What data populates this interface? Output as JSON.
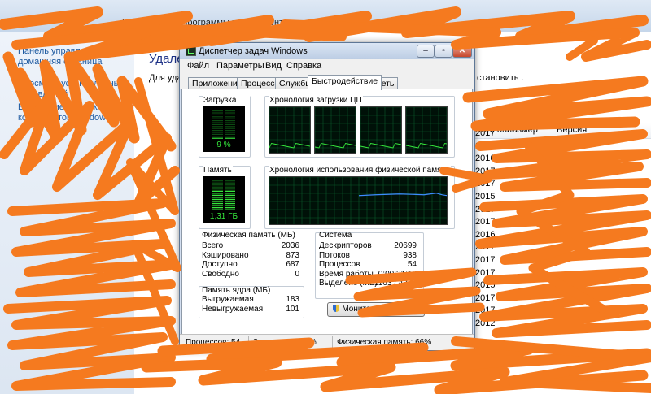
{
  "background_window": {
    "breadcrumb": [
      "Компоненты",
      "Программы и компоненты"
    ],
    "left_links": [
      "Панель управления -",
      "домашняя страница",
      "Просмотр установленных",
      "обновлений",
      "Включение или отключение",
      "компонентов Windows"
    ],
    "heading": "Удале",
    "subtext": "Для удал",
    "subtext_right": "становить .",
    "columns": [
      "Установле...",
      "Размер",
      "Версия"
    ],
    "rows": [
      {
        "date": "2017",
        "size": ""
      },
      {
        "date": "2017",
        "size": ""
      },
      {
        "date": "2016",
        "size": ""
      },
      {
        "date": "2017",
        "size": ""
      },
      {
        "date": "2017",
        "size": ""
      },
      {
        "date": "2015",
        "size": ""
      },
      {
        "date": "2017",
        "size": ""
      },
      {
        "date": "2017",
        "size": ""
      },
      {
        "date": "2016",
        "size": ""
      },
      {
        "date": "2017",
        "size": ""
      },
      {
        "date": "2017",
        "size": ""
      },
      {
        "date": "2017",
        "size": ""
      },
      {
        "date": "2015",
        "size": ""
      },
      {
        "date": "2017",
        "size": ""
      },
      {
        "date": "2017",
        "size": ""
      },
      {
        "date": "2012",
        "size": ""
      }
    ]
  },
  "task_manager": {
    "title": "Диспетчер задач Windows",
    "menu": [
      "Файл",
      "Параметры",
      "Вид",
      "Справка"
    ],
    "tabs": [
      "Приложения",
      "Процессы",
      "Службы",
      "Быстродействие",
      "Сеть"
    ],
    "active_tab": "Быстродействие",
    "cpu_usage": {
      "caption": "Загрузка ЦП",
      "value": "9 %",
      "level": 0.09
    },
    "cpu_history": {
      "caption": "Хронология загрузки ЦП",
      "cores": 4
    },
    "memory": {
      "caption": "Память",
      "value": "1,31 ГБ",
      "level": 0.66
    },
    "memory_history": {
      "caption": "Хронология использования физической памяти"
    },
    "physical_memory": {
      "title": "Физическая память (МБ)",
      "rows": [
        {
          "label": "Всего",
          "value": "2036"
        },
        {
          "label": "Кэшировано",
          "value": "873"
        },
        {
          "label": "Доступно",
          "value": "687"
        },
        {
          "label": "Свободно",
          "value": "0"
        }
      ]
    },
    "kernel_memory": {
      "title": "Память ядра (МБ)",
      "rows": [
        {
          "label": "Выгружаемая",
          "value": "183"
        },
        {
          "label": "Невыгружаемая",
          "value": "101"
        }
      ]
    },
    "system": {
      "title": "Система",
      "rows": [
        {
          "label": "Дескрипторов",
          "value": "20699"
        },
        {
          "label": "Потоков",
          "value": "938"
        },
        {
          "label": "Процессов",
          "value": "54"
        },
        {
          "label": "Время работы",
          "value": "0:00:31:18"
        },
        {
          "label": "Выделено (МБ)",
          "value": "1163 / 4373"
        }
      ]
    },
    "resource_monitor_button": "Монитор ресурсов...",
    "status": {
      "processes": "Процессов: 54",
      "cpu": "Загрузка ЦП: 9%",
      "memory": "Физическая память: 66%"
    }
  },
  "colors": {
    "scribble": "#f57a1f",
    "graph_green": "#35e63c",
    "graph_bg": "#001108",
    "mem_line": "#3d8bff"
  }
}
